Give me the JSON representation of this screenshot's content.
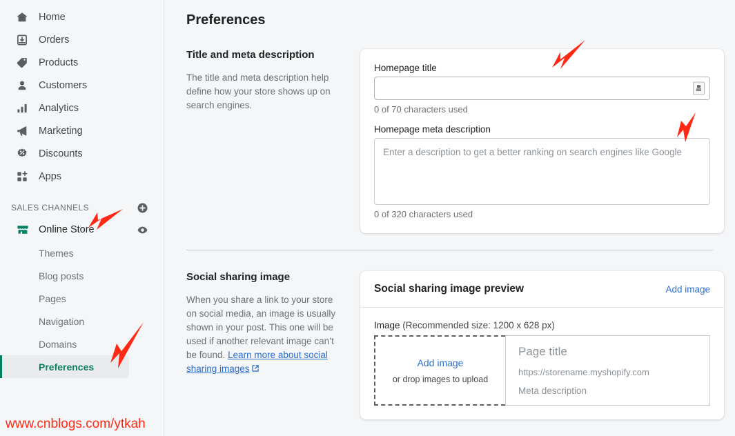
{
  "sidebar": {
    "nav": [
      {
        "label": "Home",
        "icon": "home-icon"
      },
      {
        "label": "Orders",
        "icon": "orders-icon"
      },
      {
        "label": "Products",
        "icon": "tag-icon"
      },
      {
        "label": "Customers",
        "icon": "person-icon"
      },
      {
        "label": "Analytics",
        "icon": "bar-chart-icon"
      },
      {
        "label": "Marketing",
        "icon": "megaphone-icon"
      },
      {
        "label": "Discounts",
        "icon": "discount-icon"
      },
      {
        "label": "Apps",
        "icon": "apps-grid-icon"
      }
    ],
    "sales_channels_label": "SALES CHANNELS",
    "add_channel_icon": "plus-circle-icon",
    "channel": {
      "label": "Online Store",
      "icon": "storefront-icon",
      "view_icon": "eye-icon"
    },
    "subitems": [
      {
        "label": "Themes",
        "active": false
      },
      {
        "label": "Blog posts",
        "active": false
      },
      {
        "label": "Pages",
        "active": false
      },
      {
        "label": "Navigation",
        "active": false
      },
      {
        "label": "Domains",
        "active": false
      },
      {
        "label": "Preferences",
        "active": true
      }
    ],
    "watermark": "www.cnblogs.com/ytkah"
  },
  "page": {
    "title": "Preferences"
  },
  "title_meta_section": {
    "heading": "Title and meta description",
    "description": "The title and meta description help define how your store shows up on search engines.",
    "homepage_title_label": "Homepage title",
    "homepage_title_value": "",
    "homepage_title_counter": "0 of 70 characters used",
    "insert_variable_icon": "insert-variable-icon",
    "meta_description_label": "Homepage meta description",
    "meta_description_placeholder": "Enter a description to get a better ranking on search engines like Google",
    "meta_description_value": "",
    "meta_description_counter": "0 of 320 characters used"
  },
  "social_section": {
    "heading": "Social sharing image",
    "description_before_link": "When you share a link to your store on social media, an image is usually shown in your post. This one will be used if another relevant image can’t be found. ",
    "link_text": "Learn more about social sharing images",
    "external_link_icon": "external-link-icon",
    "card": {
      "title": "Social sharing image preview",
      "add_image_action": "Add image",
      "image_label": "Image",
      "recommended_size": "(Recommended size: 1200 x 628 px)",
      "dropzone_action": "Add image",
      "dropzone_hint": "or drop images to upload",
      "preview_page_title": "Page title",
      "preview_url": "https://storename.myshopify.com",
      "preview_meta_description": "Meta description"
    }
  },
  "annotations": {
    "arrow_color": "#ff2a15",
    "arrows": [
      {
        "name": "arrow-to-homepage-title"
      },
      {
        "name": "arrow-to-meta-description"
      },
      {
        "name": "arrow-to-online-store"
      },
      {
        "name": "arrow-to-preferences"
      }
    ]
  },
  "colors": {
    "accent_green": "#008060",
    "active_text_green": "#0c7f5f",
    "link_blue": "#2c6ecb",
    "page_bg": "#f4f6f8"
  }
}
